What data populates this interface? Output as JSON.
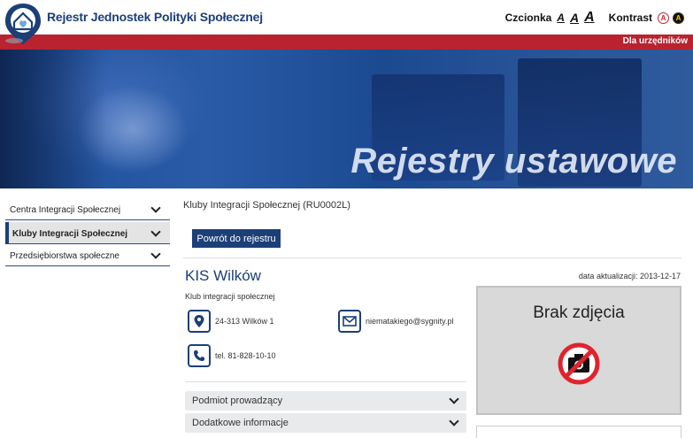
{
  "header": {
    "site_title": "Rejestr Jednostek Polityki Społecznej",
    "font_label": "Czcionka",
    "font_small": "A",
    "font_medium": "A",
    "font_large": "A",
    "contrast_label": "Kontrast",
    "contrast_light": "A",
    "contrast_dark": "A",
    "officials_link": "Dla urzędników"
  },
  "banner": {
    "title": "Rejestry ustawowe"
  },
  "sidebar": {
    "items": [
      {
        "label": "Centra Integracji Społecznej",
        "active": false
      },
      {
        "label": "Kluby Integracji Społecznej",
        "active": true
      },
      {
        "label": "Przedsiębiorstwa społeczne",
        "active": false
      }
    ]
  },
  "main": {
    "breadcrumb": "Kluby Integracji Społecznej (RU0002L)",
    "back_button": "Powrót do rejestru",
    "entity_name": "KIS Wilków",
    "update_label": "data aktualizacji: 2013-12-17",
    "entity_type": "Klub integracji społecznej",
    "address": "24-313 Wilków 1",
    "email": "niematakiego@sygnity.pl",
    "phone": "tel. 81-828-10-10",
    "accordions": [
      {
        "label": "Podmiot prowadzący"
      },
      {
        "label": "Dodatkowe informacje"
      }
    ],
    "photo_placeholder": "Brak zdjęcia"
  },
  "colors": {
    "brand_navy": "#1c3f78",
    "brand_red": "#b8232f",
    "banner_blue": "#2a5ba6"
  }
}
